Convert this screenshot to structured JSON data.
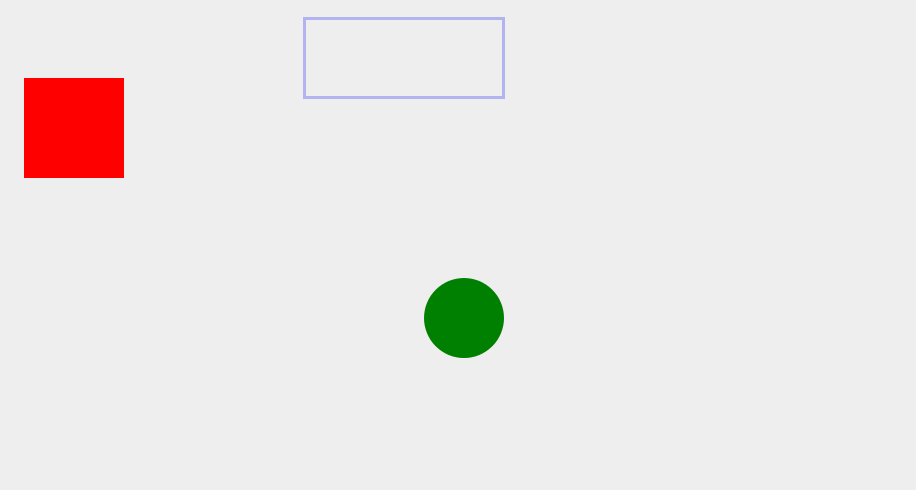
{
  "colors": {
    "background": "#eeeeee",
    "red_square": "#ff0000",
    "drop_zone_border": "#b3b3f0",
    "green_circle": "#008000"
  },
  "shapes": [
    {
      "id": "red-square",
      "kind": "square",
      "color_key": "red_square"
    },
    {
      "id": "drop-zone",
      "kind": "outlined-rectangle",
      "color_key": "drop_zone_border"
    },
    {
      "id": "green-circle",
      "kind": "circle",
      "color_key": "green_circle"
    }
  ]
}
